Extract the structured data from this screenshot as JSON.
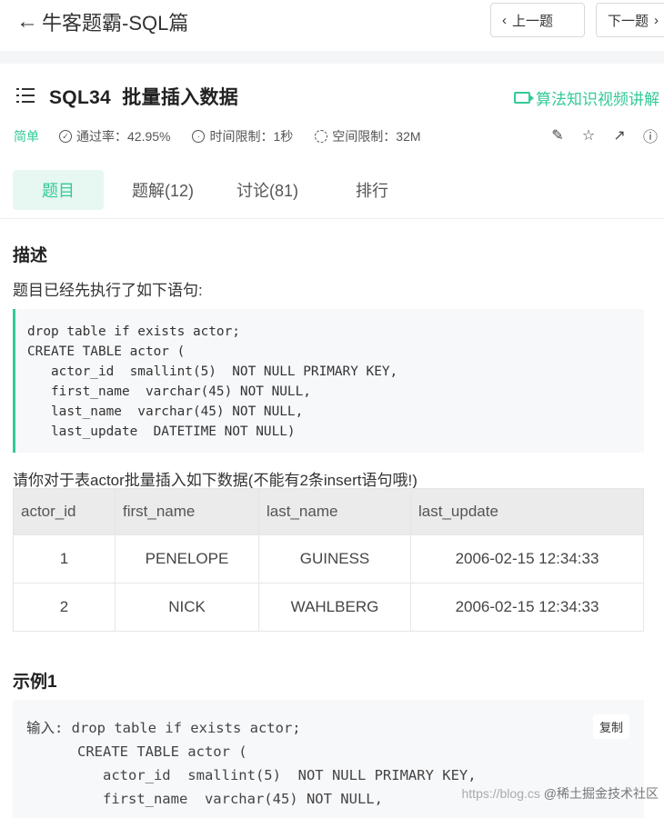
{
  "header": {
    "site_title": "牛客题霸-SQL篇",
    "prev_label": "上一题",
    "next_label": "下一题"
  },
  "problem": {
    "title": "SQL34  批量插入数据",
    "video_link": "算法知识视频讲解",
    "difficulty": "简单",
    "pass_rate": "通过率：42.95%",
    "time_limit": "时间限制：1秒",
    "space_limit": "空间限制：32M"
  },
  "tabs": [
    "题目",
    "题解(12)",
    "讨论(81)",
    "排行"
  ],
  "content": {
    "desc_heading": "描述",
    "desc_intro": "题目已经先执行了如下语句:",
    "code_lines": [
      "drop table if exists actor;",
      "CREATE TABLE actor (",
      "   actor_id  smallint(5)  NOT NULL PRIMARY KEY,",
      "   first_name  varchar(45) NOT NULL,",
      "   last_name  varchar(45) NOT NULL,",
      "   last_update  DATETIME NOT NULL)"
    ],
    "request_text": "请你对于表actor批量插入如下数据(不能有2条insert语句哦!)",
    "table": {
      "headers": [
        "actor_id",
        "first_name",
        "last_name",
        "last_update"
      ],
      "rows": [
        [
          "1",
          "PENELOPE",
          "GUINESS",
          "2006-02-15 12:34:33"
        ],
        [
          "2",
          "NICK",
          "WAHLBERG",
          "2006-02-15 12:34:33"
        ]
      ]
    },
    "example_heading": "示例1",
    "example_lines": [
      "输入: drop table if exists actor;",
      "      CREATE TABLE actor (",
      "         actor_id  smallint(5)  NOT NULL PRIMARY KEY,",
      "         first_name  varchar(45) NOT NULL,"
    ],
    "copy_label": "复制"
  },
  "watermark": {
    "faint": "https://blog.cs",
    "text": "@稀土掘金技术社区"
  },
  "colors": {
    "accent": "#32ca99",
    "text": "#333333"
  }
}
